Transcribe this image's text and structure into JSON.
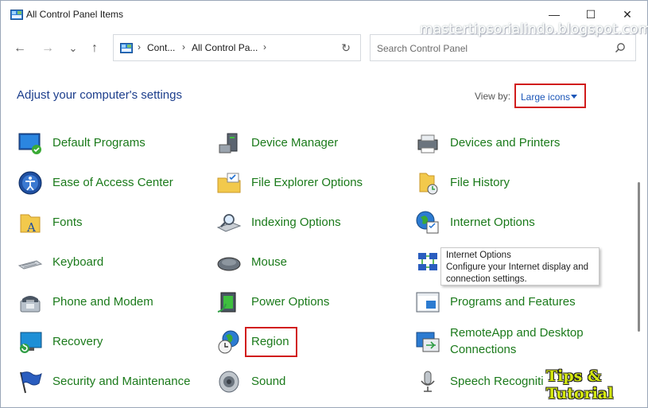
{
  "window": {
    "title": "All Control Panel Items",
    "minimize": "—",
    "maximize": "☐",
    "close": "✕"
  },
  "nav": {
    "back": "←",
    "forward": "→",
    "recent": "⌄",
    "up": "↑",
    "breadcrumbs": [
      "Cont...",
      "All Control Pa..."
    ],
    "separator": "›",
    "refresh": "↻"
  },
  "search": {
    "placeholder": "Search Control Panel"
  },
  "watermark": "mastertipsorialindo.blogspot.com",
  "header": {
    "title": "Adjust your computer's settings",
    "view_by_label": "View by:",
    "view_by_value": "Large icons"
  },
  "items": {
    "col1": [
      {
        "label": "Default Programs",
        "icon": "default-programs-icon"
      },
      {
        "label": "Ease of Access Center",
        "icon": "ease-of-access-icon"
      },
      {
        "label": "Fonts",
        "icon": "fonts-icon"
      },
      {
        "label": "Keyboard",
        "icon": "keyboard-icon"
      },
      {
        "label": "Phone and Modem",
        "icon": "phone-modem-icon"
      },
      {
        "label": "Recovery",
        "icon": "recovery-icon"
      },
      {
        "label": "Security and Maintenance",
        "icon": "flag-icon"
      }
    ],
    "col2": [
      {
        "label": "Device Manager",
        "icon": "device-manager-icon"
      },
      {
        "label": "File Explorer Options",
        "icon": "folder-options-icon"
      },
      {
        "label": "Indexing Options",
        "icon": "indexing-icon"
      },
      {
        "label": "Mouse",
        "icon": "mouse-icon"
      },
      {
        "label": "Power Options",
        "icon": "power-icon"
      },
      {
        "label": "Region",
        "icon": "globe-clock-icon"
      },
      {
        "label": "Sound",
        "icon": "speaker-icon"
      }
    ],
    "col3": [
      {
        "label": "Devices and Printers",
        "icon": "printer-icon"
      },
      {
        "label": "File History",
        "icon": "file-history-icon"
      },
      {
        "label": "Internet Options",
        "icon": "internet-options-icon"
      },
      {
        "label": "",
        "icon": "network-icon"
      },
      {
        "label": "Programs and Features",
        "icon": "programs-icon"
      },
      {
        "label": "RemoteApp and Desktop",
        "label2": "Connections",
        "icon": "remote-app-icon"
      },
      {
        "label": "Speech Recogniti",
        "icon": "microphone-icon"
      }
    ]
  },
  "tooltip": {
    "title": "Internet Options",
    "line1": "Configure your Internet display and",
    "line2": "connection settings."
  },
  "overlay_text": "Tips & Tutorial",
  "colors": {
    "link_green": "#1b7a1b",
    "heading_blue": "#1c3e8c",
    "highlight_red": "#d11c1c"
  }
}
